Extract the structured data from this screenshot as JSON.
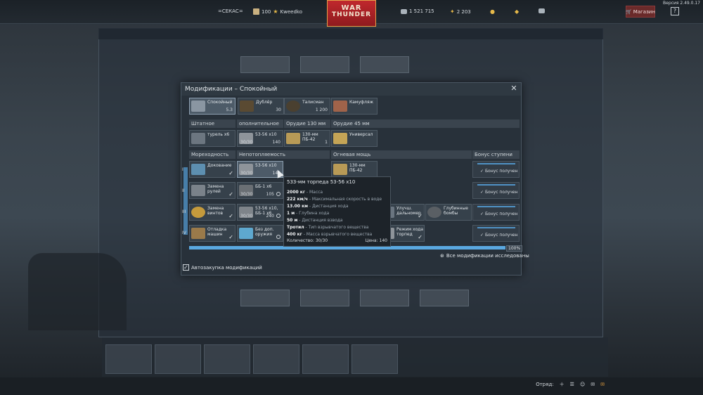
{
  "top": {
    "version": "Версия 2.49.0.17",
    "squadron_tag": "=СЕКАС=",
    "level": "100",
    "nickname": "Kweedko",
    "silver_lions": "1 521 715",
    "golden_eagles": "2 203",
    "shop_label": "Магазин",
    "help_label": "?",
    "logo_line1": "WAR",
    "logo_line2": "THUNDER"
  },
  "modal": {
    "title": "Модификации – Спокойный",
    "top_cards": [
      {
        "name": "Спокойный",
        "value": "5.3"
      },
      {
        "name": "Дублёр",
        "value": "30"
      },
      {
        "name": "Талисман",
        "value": "1 200"
      },
      {
        "name": "Камуфляж",
        "value": ""
      }
    ],
    "weapon_headers": {
      "standard": "Штатное оружие",
      "additional": "ополнительное оружие",
      "gun130": "Орудие 130 мм",
      "gun45": "Орудие 45 мм"
    },
    "weapon_cards": [
      {
        "name": "турель x6",
        "count": "",
        "price": ""
      },
      {
        "name": "53-56 x10",
        "count": "30/30",
        "price": "140"
      },
      {
        "name": "130-мм ПБ-42",
        "count": "",
        "price": "1"
      },
      {
        "name": "Универсал",
        "count": "",
        "price": ""
      }
    ],
    "mod_headers": {
      "seaworthiness": "Мореходность",
      "survivability": "Непотопляемость",
      "firepower": "Огневая мощь",
      "tier_bonus": "Бонус ступени"
    },
    "mod_cards": [
      {
        "name": "Докование"
      },
      {
        "name": "Замена рулей"
      },
      {
        "name": "Замена винтов"
      },
      {
        "name": "Отладка машин"
      },
      {
        "name": "53-56 x10",
        "count": "30/30",
        "price": "140"
      },
      {
        "name": "ББ-1 x6",
        "count": "30/30",
        "price": "105"
      },
      {
        "name": "53-56 x10, ББ-1 x6",
        "count": "30/30",
        "price": "240"
      },
      {
        "name": "Без доп. оружия"
      },
      {
        "name": "130-мм ПБ-42"
      },
      {
        "name": "Улучш. дальномер"
      },
      {
        "name": "Глубинные бомбы"
      },
      {
        "name": "Режим хода торпед"
      }
    ],
    "tiers": [
      "I",
      "II",
      "III",
      "IV"
    ],
    "bonus_text": "Бонус получен",
    "progress_pct": "100%",
    "all_researched": "Все модификации исследованы",
    "autobuy": "Автозакупка модификаций"
  },
  "tooltip": {
    "title": "533-мм торпеда 53-56 x10",
    "rows": [
      {
        "value": "2000 кг",
        "desc": " - Масса"
      },
      {
        "value": "222 км/ч",
        "desc": " - Максимальная скорость в воде"
      },
      {
        "value": "13.00 км",
        "desc": " - Дистанция хода"
      },
      {
        "value": "1 м",
        "desc": " - Глубина хода"
      },
      {
        "value": "50 м",
        "desc": " - Дистанция взвода"
      },
      {
        "value": "Тротил",
        "desc": " - Тип взрывчатого вещества"
      },
      {
        "value": "400 кг",
        "desc": " - Масса взрывчатого вещества"
      }
    ],
    "quantity": "Количество: 30/30",
    "price": "Цена: 140"
  },
  "bottom": {
    "squad_label": "Отряд:"
  },
  "colors": {
    "accent": "#4f92c5",
    "logo_red": "#c0282d",
    "panel": "#28313a"
  }
}
